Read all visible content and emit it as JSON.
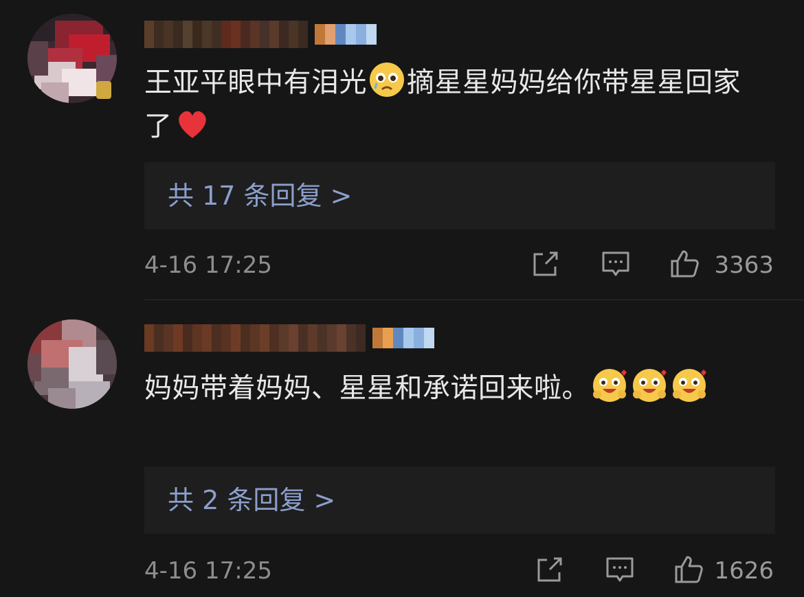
{
  "comments": [
    {
      "text_pre": "王亚平眼中有泪光",
      "emoji_mid": "pleading-face",
      "text_post": "摘星星妈妈给你带星星回家了",
      "emoji_end": "red-heart",
      "replies_label": "共 17 条回复 >",
      "time": "4-16 17:25",
      "likes": "3363"
    },
    {
      "text_pre": "妈妈带着妈妈、星星和承诺回来啦。",
      "emojis": [
        "hugging-face",
        "hugging-face",
        "hugging-face"
      ],
      "replies_label": "共 2 条回复 >",
      "time": "4-16 17:25",
      "likes": "1626"
    }
  ],
  "colors": {
    "background": "#161616",
    "reply_box": "#1e1e1e",
    "link": "#8c9fcc",
    "meta": "#8e8e8e"
  }
}
